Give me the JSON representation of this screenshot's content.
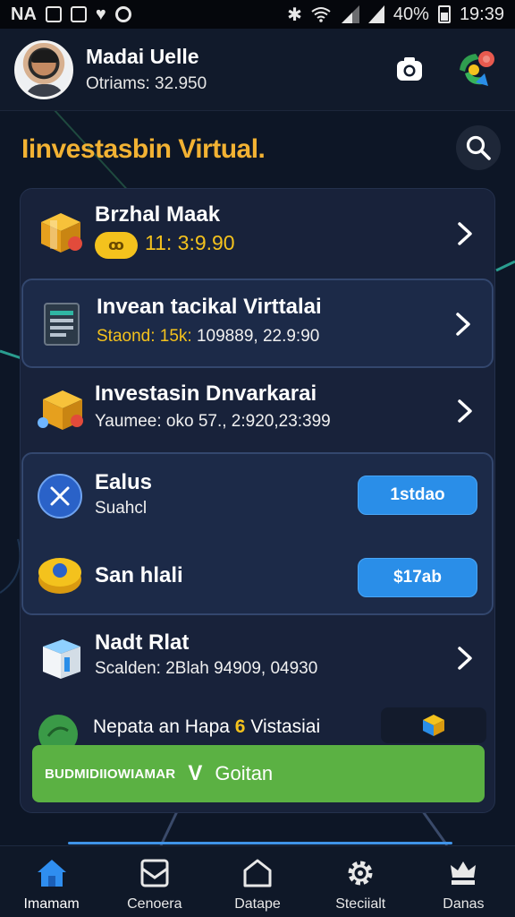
{
  "status_bar": {
    "carrier": "NA",
    "battery": "40%",
    "time": "19:39"
  },
  "header": {
    "user_name": "Madai Uelle",
    "user_sub": "Otriams: 32.950"
  },
  "page_title": "Iinvestasbin Virtual.",
  "rows": [
    {
      "title": "Brzhal Maak",
      "badge": "ꝏ",
      "value": "11: 3:9.90"
    },
    {
      "title": "Invean tacikal Virttalai",
      "sub_prefix": "Staond: 15k:",
      "sub": "109889, 22.9:90"
    },
    {
      "title": "Investasin Dnvarkarai",
      "sub": "Yaumee: oko 57., 2:920,23:399"
    },
    {
      "title": "Ealus",
      "sub": "Suahcl",
      "button": "1stdao"
    },
    {
      "title": "San hlali",
      "button": "$17ab"
    },
    {
      "title": "Nadt Rlat",
      "sub": "Scalden: 2Blah 94909, 04930"
    }
  ],
  "promo": {
    "text_prefix": "Nepata an Hapa",
    "number": "6",
    "text_suffix": "Vistasiai"
  },
  "cta": {
    "small_text": "BUDMIDIIOWIAMAR",
    "v_mark": "V",
    "label": "Goitan"
  },
  "nav": [
    {
      "label": "Imamam",
      "icon": "home-icon"
    },
    {
      "label": "Cenoera",
      "icon": "inbox-icon"
    },
    {
      "label": "Datape",
      "icon": "shield-home-icon"
    },
    {
      "label": "Steciialt",
      "icon": "gear-icon"
    },
    {
      "label": "Danas",
      "icon": "crown-icon"
    }
  ],
  "colors": {
    "accent_gold": "#f2b233",
    "button_blue": "#2a8ee8",
    "cta_green": "#5bb143",
    "background": "#0d1626"
  }
}
